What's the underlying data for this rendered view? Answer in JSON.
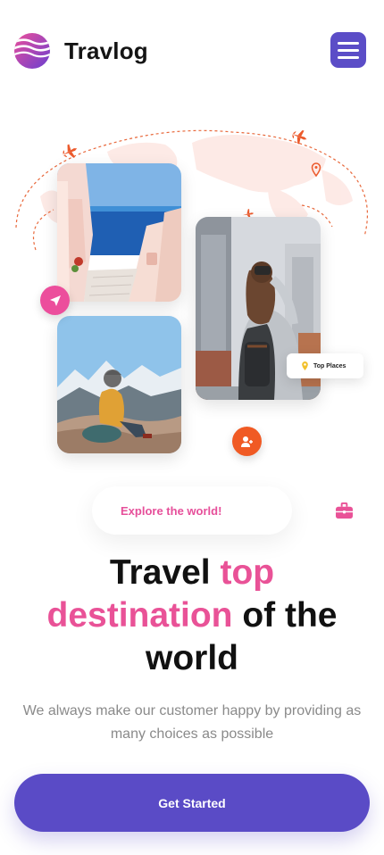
{
  "header": {
    "brand": "Travlog",
    "logo_icon": "travlog-logo-icon",
    "menu_icon": "hamburger-menu-icon"
  },
  "hero": {
    "badge_label": "Top Places",
    "icons": [
      "paper-plane-icon",
      "add-user-icon",
      "location-pin-icon",
      "airplane-icon"
    ]
  },
  "explore": {
    "label": "Explore the world!",
    "icon": "suitcase-icon"
  },
  "headline": {
    "part1": "Travel ",
    "part2": "top",
    "part3": "destination",
    "part4": " of the",
    "part5": "world"
  },
  "subtitle": "We always make our customer happy by providing as many choices as possible",
  "cta": {
    "label": "Get Started"
  },
  "colors": {
    "primary": "#5a4bc6",
    "accent_pink": "#e95297",
    "accent_orange": "#f05a24"
  }
}
